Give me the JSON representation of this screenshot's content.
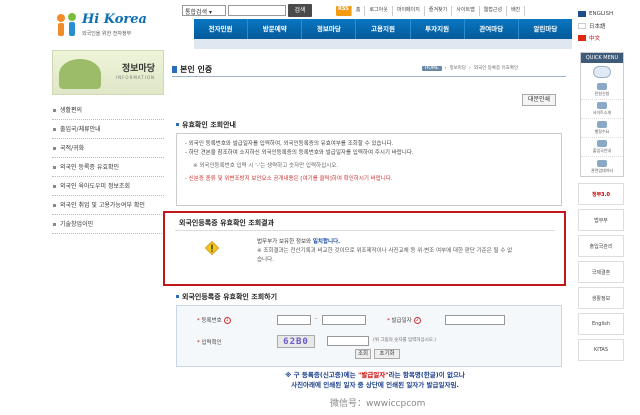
{
  "header": {
    "logo_brand": "Hi Korea",
    "logo_sub": "외국인을 위한 전자정부",
    "search_select": "통합검색",
    "search_button": "검색",
    "top_links": [
      "RSS",
      "홈",
      "로그아웃",
      "마이페이지",
      "즐겨찾기",
      "사이트맵",
      "웹접근성",
      "배진"
    ],
    "languages": [
      {
        "label": "ENGLISH",
        "color": "#1f4e8a",
        "active": false
      },
      {
        "label": "日本語",
        "color": "#ffffff",
        "active": false
      },
      {
        "label": "中文",
        "color": "#de2910",
        "active": true
      }
    ],
    "nav": [
      "전자민원",
      "방문예약",
      "정보마당",
      "고용지원",
      "투자지원",
      "관여마당",
      "알린마당"
    ]
  },
  "quick_menu": {
    "title": "QUICK MENU",
    "items": [
      "민원신청",
      "사이트소개",
      "행정수요",
      "출입국안내",
      "관련업데이터"
    ]
  },
  "banners": [
    "정부3.0",
    "법무부",
    "출입국관리",
    "국제결혼",
    "생활정보",
    "English",
    "KITAS"
  ],
  "sidebar": {
    "title": "정보마당",
    "subtitle": "INFORMATION",
    "items": [
      "생활편의",
      "출입국/체류안내",
      "국적/귀화",
      "외국인 등록증 유효확인",
      "외국인 육아도우미 정보조회",
      "외국인 취업 및 고용가능여부 확인",
      "기술창업이민"
    ]
  },
  "main": {
    "page_title": "본인 인증",
    "breadcrumb": [
      "HOME",
      "정보마당",
      "외국인 등록증 유효확인"
    ],
    "help_button": "대문인쇄",
    "guide_title": "유효확인 조회안내",
    "guide_lines": [
      "- 외국인 등록번호와 발급일자를 입력하여, 외국인등록증의 유효여부를 조회할 수 있습니다.",
      "- 하단 견본을 참조하여 소지하신 외국인등록증의 등록번호와 발급일자를 입력하여 주시기 바랍니다.",
      "※ 외국인등록번호 입력 시 '-'는 생략하고 숫자만 입력하십시오.",
      "- 신분증 종류 및 위변조방지 보안요소 공개내용은 [여기를 클릭]하여 확인하시기 바랍니다."
    ],
    "result_title": "외국인등록증 유효확인 조회결과",
    "result_main_prefix": "법무부가 보유한 정보와 ",
    "result_main_bold": "일치합니다.",
    "result_note": "※ 조회결과는 전산기록과 비교한 것이므로 위조제작이나 사진교체 등 위·변조 여부에 대한 판단 기준은 될 수 없습니다.",
    "form_title": "외국인등록증 유효확인 조회하기",
    "form": {
      "reg_no_label": "등록번호",
      "issue_date_label": "발급일자",
      "captcha_label": "입력확인",
      "captcha_text": "62B0",
      "captcha_note": "(위 그림의 숫자를 입력하십시오.)",
      "num1": "1",
      "num2": "2",
      "confirm_button": "조회",
      "reset_button": "초기화"
    },
    "bottom_note_line1_a": "※ 구 등록증(신고증)에는 ",
    "bottom_note_line1_b": "\"발급일자\"",
    "bottom_note_line1_c": "라는 항목명(한글)이 없으나",
    "bottom_note_line2": "사진아래에 인쇄된 일자 중 상단에 인쇄된 일자가 발급일자임."
  },
  "watermark": "微信号：wwwiccpcom"
}
